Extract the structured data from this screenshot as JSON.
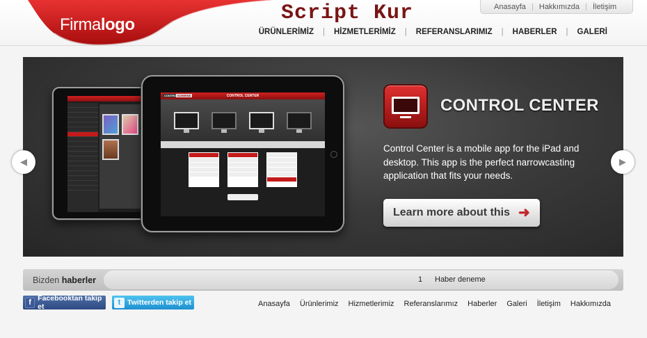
{
  "header": {
    "logo": {
      "light": "Firma",
      "bold": "logo"
    },
    "site_title": "Script Kur",
    "top_links": [
      "Anasayfa",
      "Hakkımızda",
      "İletişim"
    ],
    "main_nav": [
      "ÜRÜNLERİMİZ",
      "HİZMETLERİMİZ",
      "REFERANSLARIMIZ",
      "HABERLER",
      "GALERİ"
    ],
    "nav_separator": "|"
  },
  "slider": {
    "title": "CONTROL CENTER",
    "description": "Control Center is a mobile app for the iPad and desktop.  This app is the perfect narrowcasting application that fits your needs.",
    "button_label": "Learn more about this",
    "button_arrow": "➜",
    "prev_icon": "◀",
    "next_icon": "▶",
    "screen_header": "CONTROL CENTER",
    "screen_tabs": [
      "CONTROL",
      "SCREENS"
    ],
    "accent_color": "#c41a1a"
  },
  "news": {
    "label_light": "Bizden",
    "label_bold": "haberler",
    "item_number": "1",
    "item_text": "Haber deneme"
  },
  "social": {
    "facebook_label": "Facebooktan takip et",
    "facebook_icon": "f",
    "twitter_label": "Twitterden takip et",
    "twitter_icon": "t"
  },
  "footer_nav": [
    "Anasayfa",
    "Ürünlerimiz",
    "Hizmetlerimiz",
    "Referanslarımız",
    "Haberler",
    "Galeri",
    "İletişim",
    "Hakkımızda"
  ]
}
